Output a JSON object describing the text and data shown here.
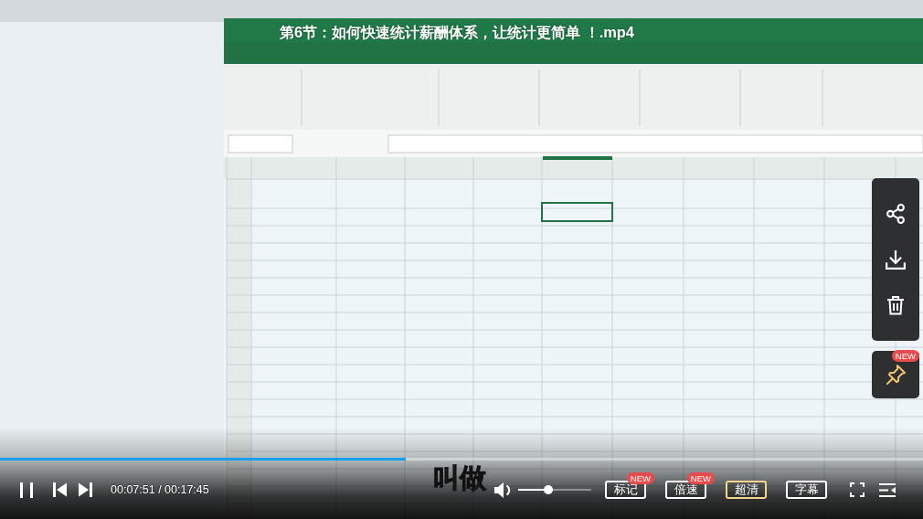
{
  "video": {
    "title": "第6节：如何快速统计薪酬体系，让统计更简单 ！.mp4",
    "subtitle": "叫做"
  },
  "side_tools": {
    "pin_badge": "NEW"
  },
  "controls": {
    "progress": {
      "level": 0.44
    },
    "playing": true,
    "time": "00:07:51 / 00:17:45",
    "volume": {
      "level": 0.41
    },
    "options": [
      {
        "label": "标记",
        "badge": "NEW",
        "highlighted": false
      },
      {
        "label": "倍速",
        "badge": "NEW",
        "highlighted": false
      },
      {
        "label": "超清",
        "highlighted": true
      },
      {
        "label": "字幕",
        "highlighted": false
      }
    ]
  }
}
